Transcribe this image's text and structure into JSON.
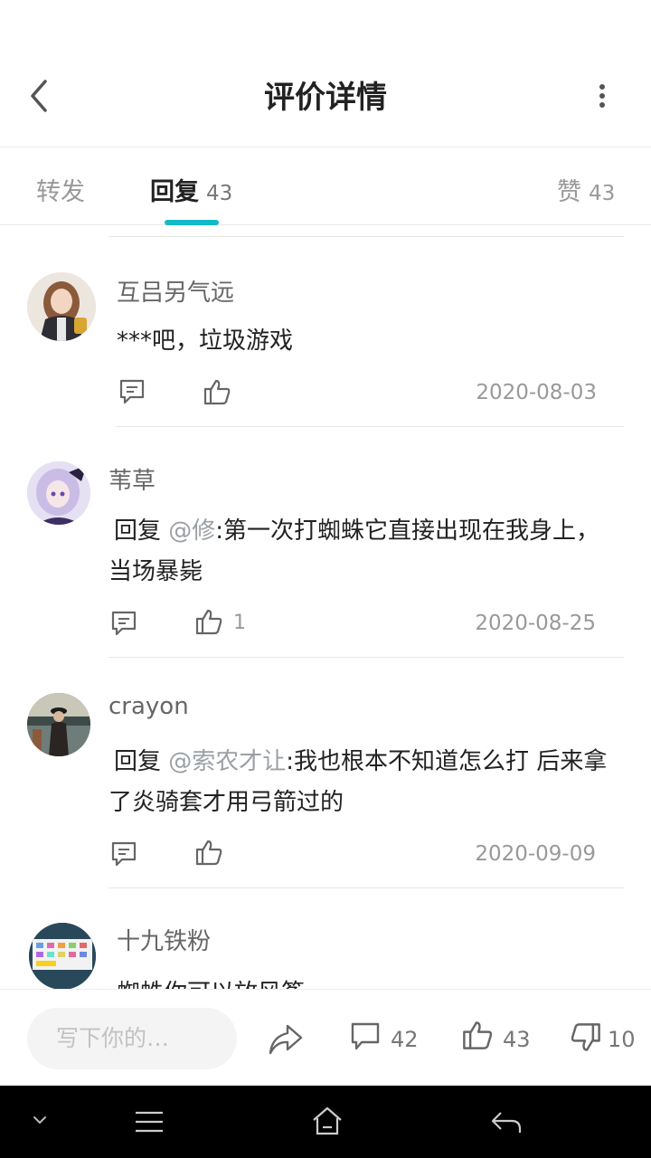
{
  "header": {
    "title": "评价详情",
    "back_icon": "chevron-left-icon",
    "more_icon": "vertical-dots-icon"
  },
  "tabs": {
    "forward": {
      "label": "转发"
    },
    "reply": {
      "label": "回复",
      "count": "43"
    },
    "like": {
      "label": "赞",
      "count": "43"
    }
  },
  "comments": [
    {
      "username": "互吕另气远",
      "text": "***吧，垃圾游戏",
      "date": "2020-08-03",
      "likes": ""
    },
    {
      "username": "苇草",
      "reply_prefix": "回复",
      "mention": "@修",
      "text": ":第一次打蜘蛛它直接出现在我身上，当场暴毙",
      "date": "2020-08-25",
      "likes": "1"
    },
    {
      "username": "crayon",
      "reply_prefix": "回复",
      "mention": "@索农才让",
      "text": ":我也根本不知道怎么打 后来拿了炎骑套才用弓箭过的",
      "date": "2020-09-09",
      "likes": ""
    },
    {
      "username": "十九铁粉",
      "text": "蜘蛛你可以放风筝"
    }
  ],
  "bottom_bar": {
    "input_placeholder": "写下你的…",
    "comment_count": "42",
    "like_count": "43",
    "dislike_count": "10"
  },
  "colors": {
    "accent": "#14b9c8",
    "mention": "#9aa0a6"
  }
}
